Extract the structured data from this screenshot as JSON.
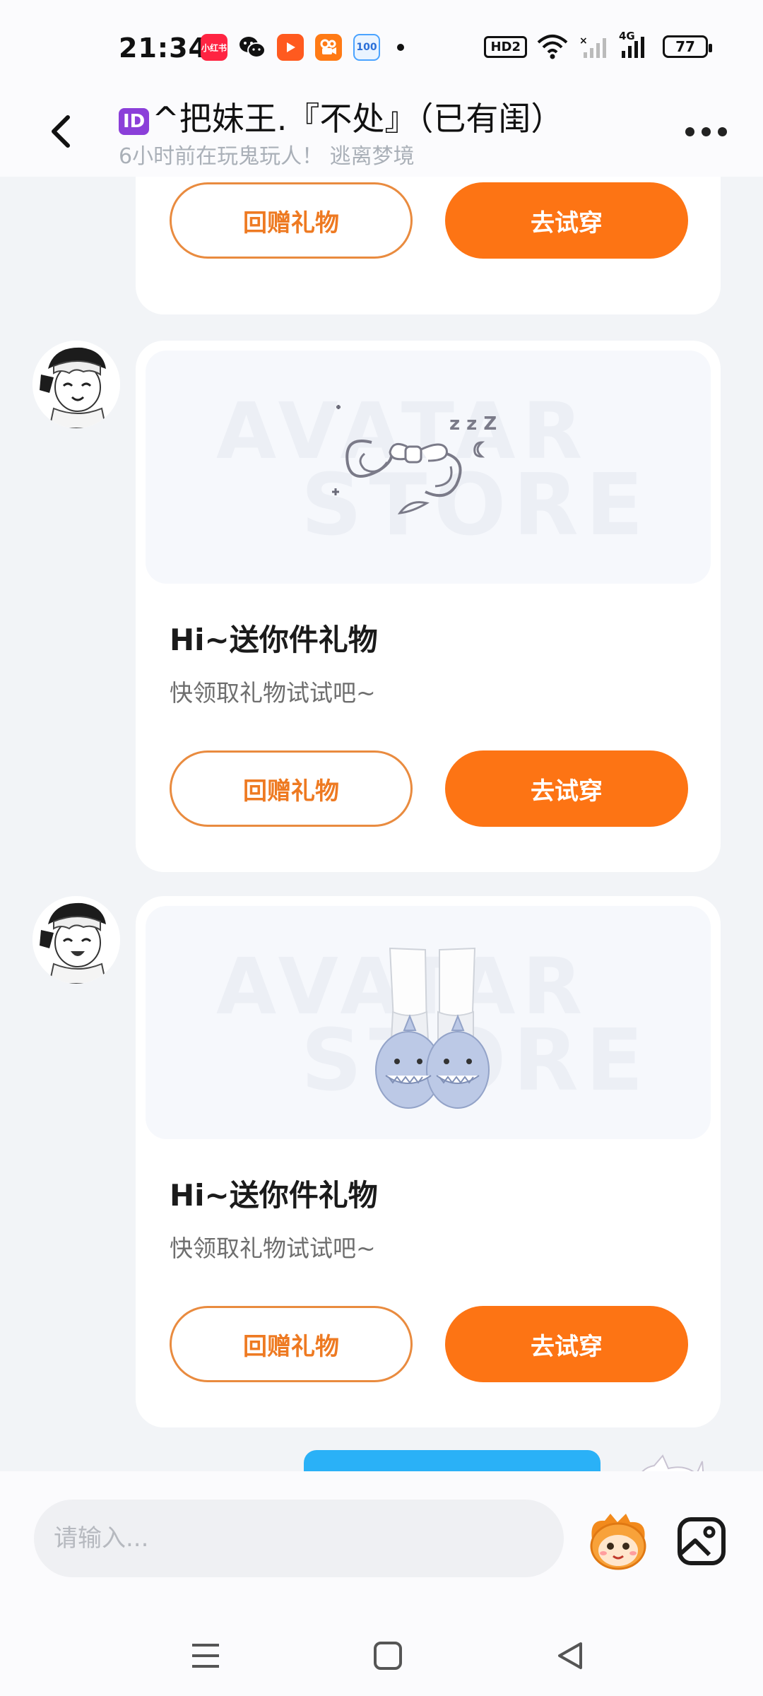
{
  "status_bar": {
    "time": "21:34",
    "hd_label": "HD2",
    "network_label": "4G",
    "battery": "77",
    "apps": [
      {
        "name": "xiaohongshu-icon",
        "label": "小红书",
        "color": "#ff2442"
      },
      {
        "name": "wechat-icon",
        "label": "",
        "color": "#1a1a1a"
      },
      {
        "name": "video-icon",
        "label": "",
        "color": "#ff5a1f"
      },
      {
        "name": "kuaishou-icon",
        "label": "",
        "color": "#ff7a15"
      },
      {
        "name": "homework-icon",
        "label": "100",
        "color": "#4aa3ff"
      }
    ]
  },
  "header": {
    "badge": "ID",
    "title": "^把妹王.『不处』（已有闺）",
    "subtitle": "6小时前在玩鬼玩人！ 逃离梦境"
  },
  "cards": [
    {
      "title": "",
      "desc": "",
      "return_gift_label": "回赠礼物",
      "try_on_label": "去试穿"
    },
    {
      "title": "Hi~送你件礼物",
      "desc": "快领取礼物试试吧~",
      "watermark_top": "AVATAR",
      "watermark_bottom": "STORE",
      "return_gift_label": "回赠礼物",
      "try_on_label": "去试穿"
    },
    {
      "title": "Hi~送你件礼物",
      "desc": "快领取礼物试试吧~",
      "watermark_top": "AVATAR",
      "watermark_bottom": "STORE",
      "return_gift_label": "回赠礼物",
      "try_on_label": "去试穿"
    }
  ],
  "input": {
    "placeholder": "请输入..."
  },
  "colors": {
    "accent": "#fd7414",
    "accent_outline": "#e98b3f",
    "bubble_blue": "#2ab1f7"
  }
}
